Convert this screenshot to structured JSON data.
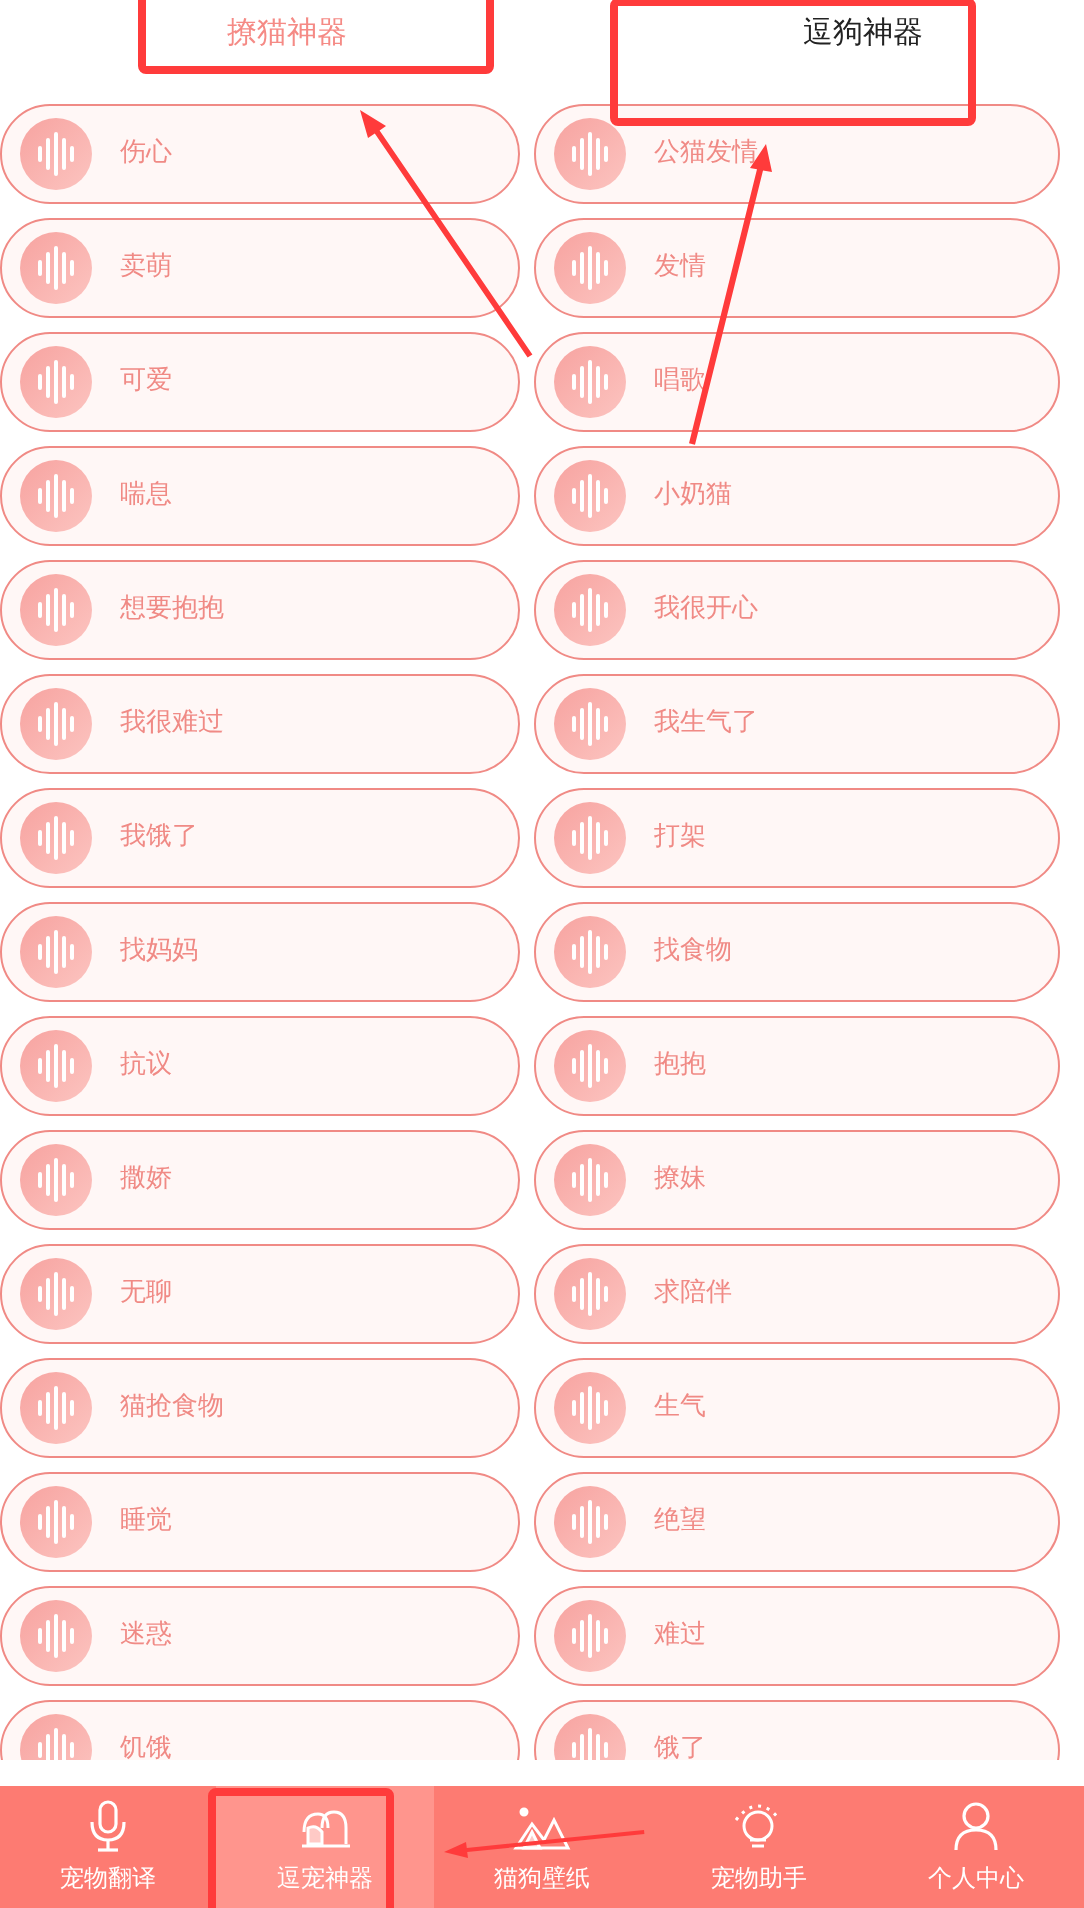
{
  "tabs": [
    {
      "label": "撩猫神器",
      "selected": true
    },
    {
      "label": "逗狗神器",
      "selected": false
    }
  ],
  "sounds": [
    {
      "left": "伤心",
      "right": "公猫发情"
    },
    {
      "left": "卖萌",
      "right": "发情"
    },
    {
      "left": "可爱",
      "right": "唱歌"
    },
    {
      "left": "喘息",
      "right": "小奶猫"
    },
    {
      "left": "想要抱抱",
      "right": "我很开心"
    },
    {
      "left": "我很难过",
      "right": "我生气了"
    },
    {
      "left": "我饿了",
      "right": "打架"
    },
    {
      "left": "找妈妈",
      "right": "找食物"
    },
    {
      "left": "抗议",
      "right": "抱抱"
    },
    {
      "left": "撒娇",
      "right": "撩妹"
    },
    {
      "left": "无聊",
      "right": "求陪伴"
    },
    {
      "left": "猫抢食物",
      "right": "生气"
    },
    {
      "left": "睡觉",
      "right": "绝望"
    },
    {
      "left": "迷惑",
      "right": "难过"
    },
    {
      "left": "饥饿",
      "right": "饿了"
    }
  ],
  "nav": [
    {
      "kind": "mic",
      "label": "宠物翻译",
      "selected": false
    },
    {
      "kind": "paws",
      "label": "逗宠神器",
      "selected": true
    },
    {
      "kind": "mountain",
      "label": "猫狗壁纸",
      "selected": false
    },
    {
      "kind": "bulb",
      "label": "宠物助手",
      "selected": false
    },
    {
      "kind": "person",
      "label": "个人中心",
      "selected": false
    }
  ]
}
